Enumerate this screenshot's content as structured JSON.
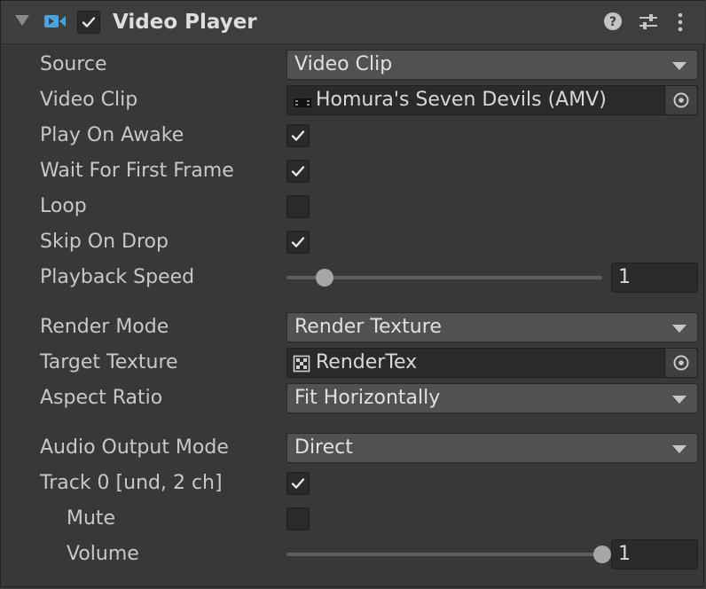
{
  "header": {
    "title": "Video Player",
    "enabled": true,
    "icons": [
      "video-player-component-icon",
      "help-icon",
      "presets-icon",
      "more-options-icon"
    ]
  },
  "fields": {
    "source": {
      "label": "Source",
      "value": "Video Clip"
    },
    "video_clip": {
      "label": "Video Clip",
      "value": "Homura's Seven Devils (AMV)",
      "icon": "video-clip-icon"
    },
    "play_on_awake": {
      "label": "Play On Awake",
      "checked": true
    },
    "wait_for_first_frame": {
      "label": "Wait For First Frame",
      "checked": true
    },
    "loop": {
      "label": "Loop",
      "checked": false
    },
    "skip_on_drop": {
      "label": "Skip On Drop",
      "checked": true
    },
    "playback_speed": {
      "label": "Playback Speed",
      "value": "1",
      "slider_fraction": 0.12
    },
    "render_mode": {
      "label": "Render Mode",
      "value": "Render Texture"
    },
    "target_texture": {
      "label": "Target Texture",
      "value": "RenderTex",
      "icon": "render-texture-icon"
    },
    "aspect_ratio": {
      "label": "Aspect Ratio",
      "value": "Fit Horizontally"
    },
    "audio_output_mode": {
      "label": "Audio Output Mode",
      "value": "Direct"
    },
    "track0": {
      "label": "Track 0 [und, 2 ch]",
      "checked": true
    },
    "mute": {
      "label": "Mute",
      "checked": false
    },
    "volume": {
      "label": "Volume",
      "value": "1",
      "slider_fraction": 1.0
    }
  },
  "colors": {
    "panel_bg": "#383838",
    "header_bg": "#3e3e3e",
    "dropdown_bg": "#515151",
    "field_bg": "#2a2a2a",
    "text": "#c8c8c8",
    "icon_blue": "#4aa3df"
  }
}
